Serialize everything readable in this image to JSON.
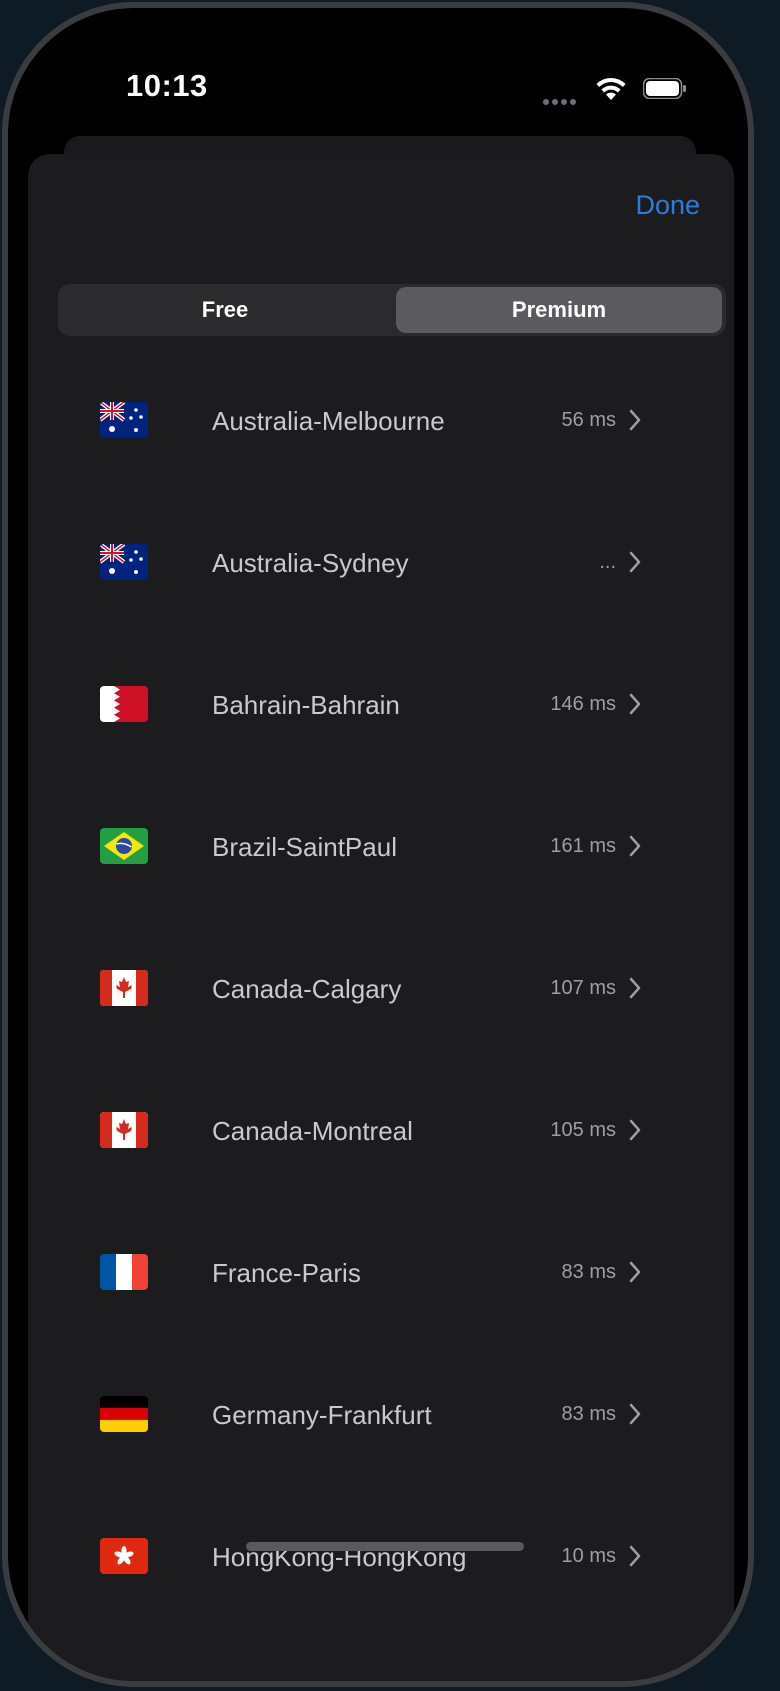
{
  "status_bar": {
    "time": "10:13"
  },
  "header": {
    "done_label": "Done"
  },
  "tabs": [
    {
      "label": "Free",
      "selected": false
    },
    {
      "label": "Premium",
      "selected": true
    }
  ],
  "servers": [
    {
      "flag": "AU",
      "name": "Australia-Melbourne",
      "ping": "56 ms"
    },
    {
      "flag": "AU",
      "name": "Australia-Sydney",
      "ping": "..."
    },
    {
      "flag": "BH",
      "name": "Bahrain-Bahrain",
      "ping": "146 ms"
    },
    {
      "flag": "BR",
      "name": "Brazil-SaintPaul",
      "ping": "161 ms"
    },
    {
      "flag": "CA",
      "name": "Canada-Calgary",
      "ping": "107 ms"
    },
    {
      "flag": "CA",
      "name": "Canada-Montreal",
      "ping": "105 ms"
    },
    {
      "flag": "FR",
      "name": "France-Paris",
      "ping": "83 ms"
    },
    {
      "flag": "DE",
      "name": "Germany-Frankfurt",
      "ping": "83 ms"
    },
    {
      "flag": "HK",
      "name": "HongKong-HongKong",
      "ping": "10 ms"
    }
  ],
  "colors": {
    "accent": "#2f7bdc",
    "sheet_background": "#1c1c1e",
    "segment_selected": "#5b5b5f"
  }
}
